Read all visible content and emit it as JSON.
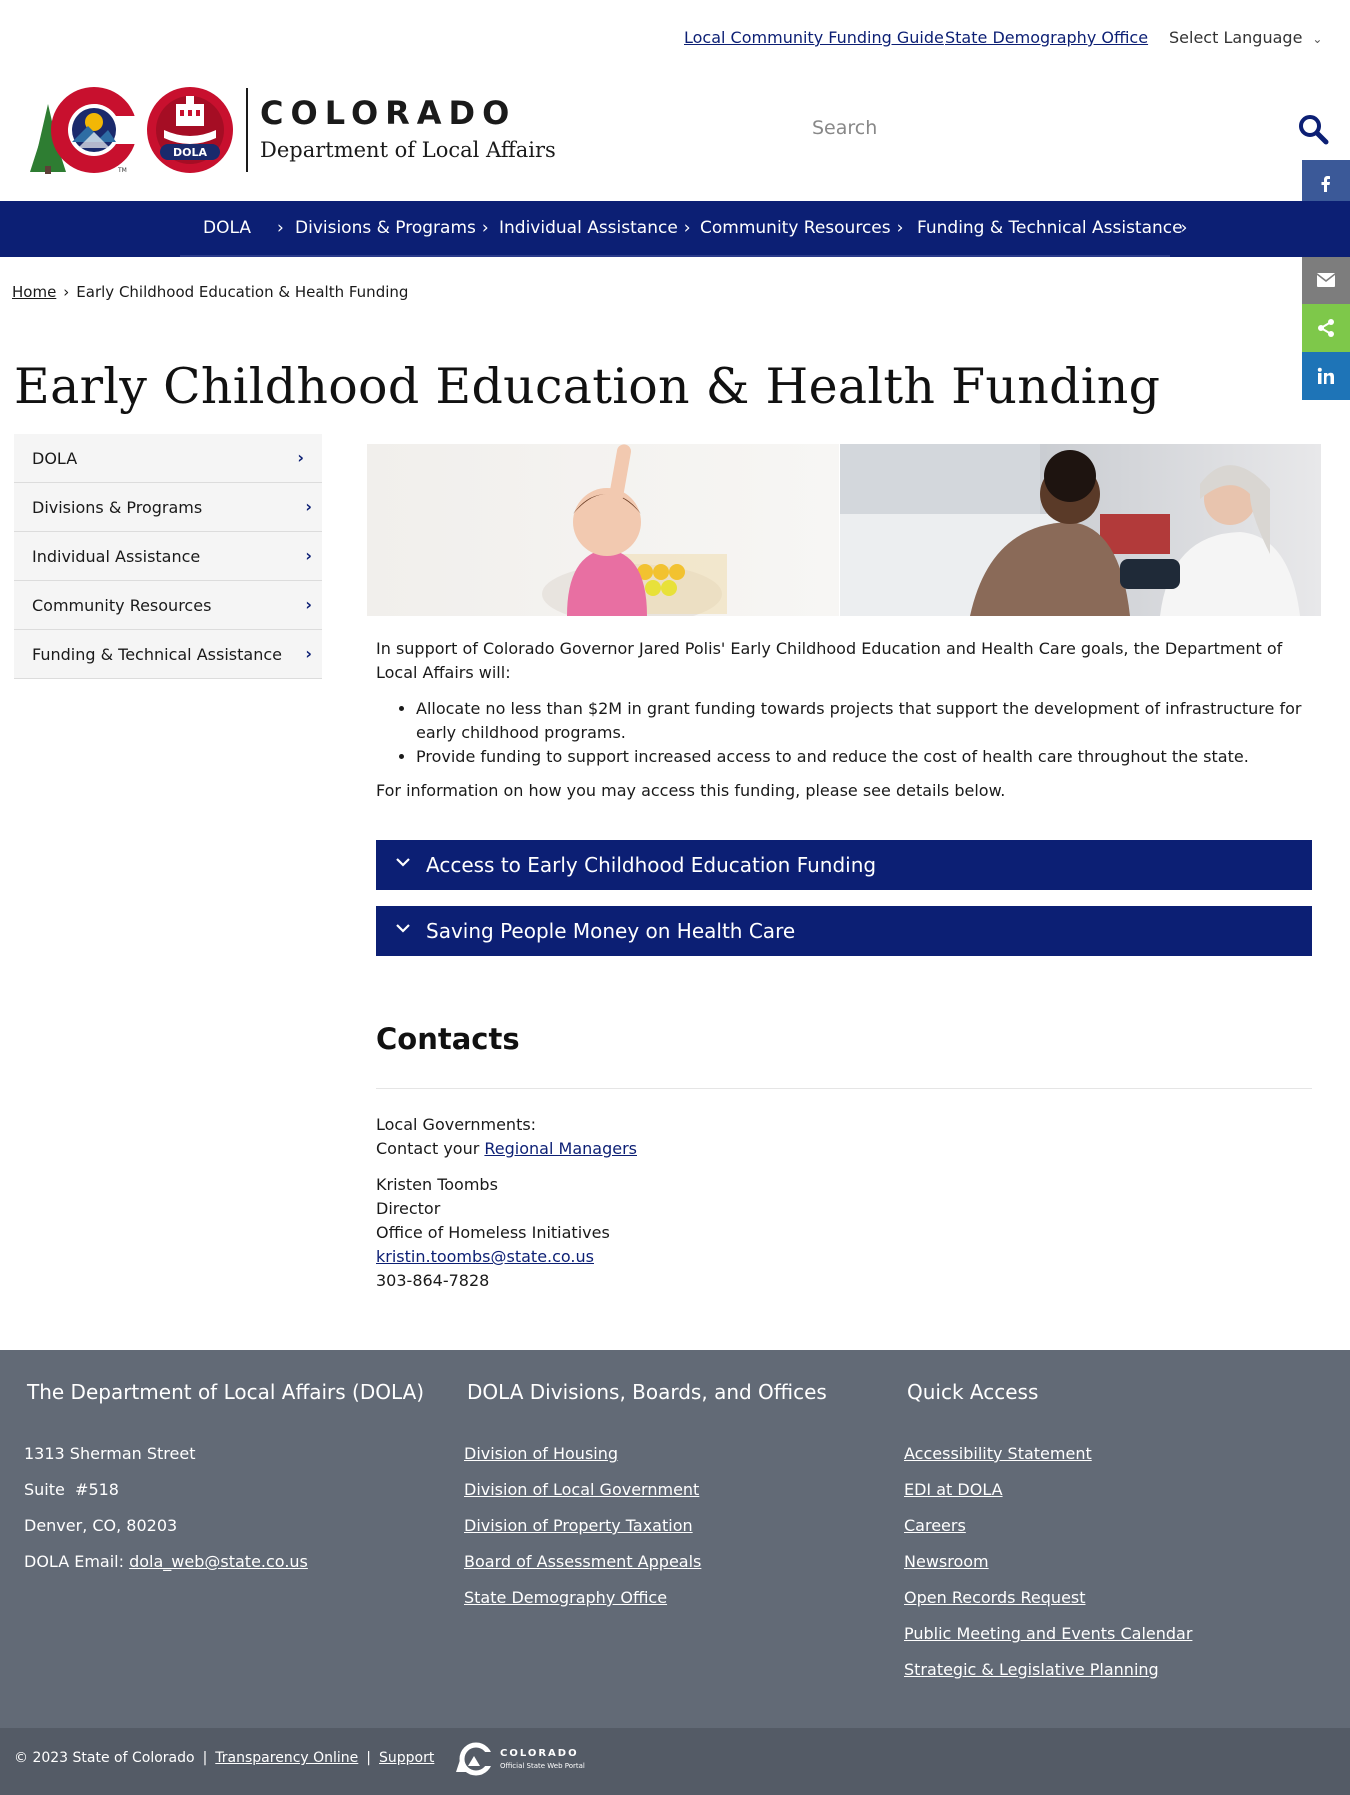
{
  "utility": {
    "link_funding_guide": "Local Community Funding Guide",
    "link_demography": "State Demography Office",
    "language_label": "Select Language"
  },
  "header": {
    "brand_state": "COLORADO",
    "brand_department": "Department of Local Affairs",
    "dola_badge": "DOLA",
    "search_placeholder": "Search"
  },
  "nav": {
    "items": [
      {
        "label": "DOLA"
      },
      {
        "label": "Divisions & Programs"
      },
      {
        "label": "Individual Assistance"
      },
      {
        "label": "Community Resources"
      },
      {
        "label": "Funding & Technical Assistance"
      }
    ]
  },
  "breadcrumb": {
    "home": "Home",
    "current": "Early Childhood Education & Health Funding"
  },
  "page": {
    "title": "Early Childhood Education & Health Funding"
  },
  "sidebar": {
    "items": [
      {
        "label": "DOLA"
      },
      {
        "label": "Divisions & Programs"
      },
      {
        "label": "Individual Assistance"
      },
      {
        "label": "Community Resources"
      },
      {
        "label": "Funding & Technical Assistance"
      }
    ]
  },
  "content": {
    "intro": "In support of Colorado Governor Jared Polis' Early Childhood Education and Health Care goals, the Department of Local Affairs will:",
    "bullets": [
      "Allocate no less than $2M in grant funding towards projects that support the development of infrastructure for early childhood programs.",
      "Provide funding to support increased access to and reduce the cost of health care throughout the state."
    ],
    "outro": "For information on how you may access this funding, please see details below.",
    "accordions": [
      {
        "label": "Access to Early Childhood Education Funding"
      },
      {
        "label": "Saving People Money on Health Care"
      }
    ]
  },
  "contacts": {
    "heading": "Contacts",
    "local_gov_label": "Local Governments:",
    "contact_your": "Contact your",
    "regional_managers": "Regional Managers",
    "name": "Kristen Toombs",
    "role": "Director",
    "office": "Office of Homeless Initiatives",
    "email": "kristin.toombs@state.co.us",
    "phone": "303-864-7828"
  },
  "footer": {
    "col1": {
      "heading": "The Department of Local Affairs (DOLA)",
      "address1": "1313 Sherman Street",
      "address2": "Suite  #518",
      "address3": "Denver, CO, 80203",
      "email_label": "DOLA Email:",
      "email": "dola_web@state.co.us"
    },
    "col2": {
      "heading": "DOLA Divisions, Boards, and Offices",
      "links": [
        "Division of Housing",
        "Division of Local Government",
        "Division of Property Taxation",
        "Board of Assessment Appeals",
        "State Demography Office"
      ]
    },
    "col3": {
      "heading": "Quick Access",
      "links": [
        "Accessibility Statement",
        "EDI at DOLA",
        "Careers",
        "Newsroom",
        "Open Records Request",
        "Public Meeting and Events Calendar",
        "Strategic & Legislative Planning"
      ]
    },
    "copyright": "© 2023 State of Colorado",
    "transparency": "Transparency Online",
    "support": "Support",
    "portal_title": "COLORADO",
    "portal_sub": "Official State Web Portal"
  },
  "colors": {
    "primary_navy": "#0c1f74",
    "footer_gray": "#626a76",
    "facebook": "#3b5998",
    "twitter": "#4a9fe5",
    "email_share": "#7d7d7d",
    "share": "#7ec84a",
    "linkedin": "#1e74b7",
    "logo_red": "#c8102e"
  },
  "icons": {
    "share_rail": [
      "facebook-icon",
      "twitter-icon",
      "email-icon",
      "share-icon",
      "linkedin-icon"
    ],
    "search": "search-icon",
    "accordion": "chevron-down-icon"
  }
}
